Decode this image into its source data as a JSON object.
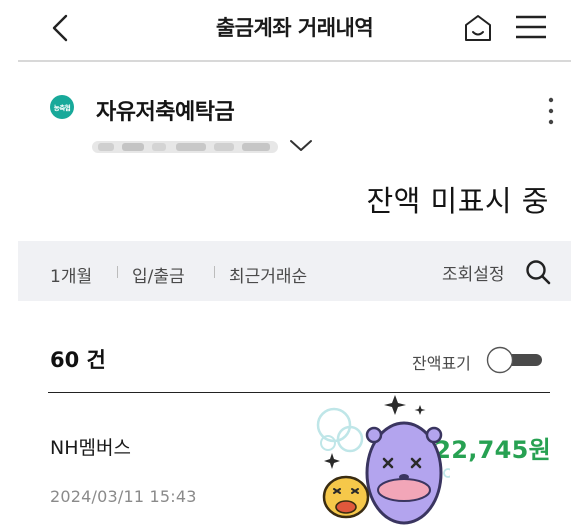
{
  "header": {
    "title": "출금계좌 거래내역",
    "back_icon": "chevron-left-icon",
    "home_icon": "home-icon",
    "menu_icon": "hamburger-menu-icon"
  },
  "account": {
    "bank_logo_text": "농축협",
    "name": "자유저축예탁금",
    "balance_status": "잔액 미표시 중",
    "more_icon": "more-vertical-icon"
  },
  "filters": {
    "period": "1개월",
    "type": "입/출금",
    "order": "최근거래순",
    "settings_label": "조회설정",
    "search_icon": "search-icon"
  },
  "list": {
    "count_label": "60 건",
    "toggle_label": "잔액표기",
    "toggle_on": false
  },
  "transactions": [
    {
      "name": "NH멤버스",
      "date": "2024/03/11  15:43",
      "amount": "22,745원"
    }
  ],
  "colors": {
    "accent_green": "#27a152",
    "logo_teal": "#18a99a",
    "filter_bg": "#f0f1f4"
  }
}
